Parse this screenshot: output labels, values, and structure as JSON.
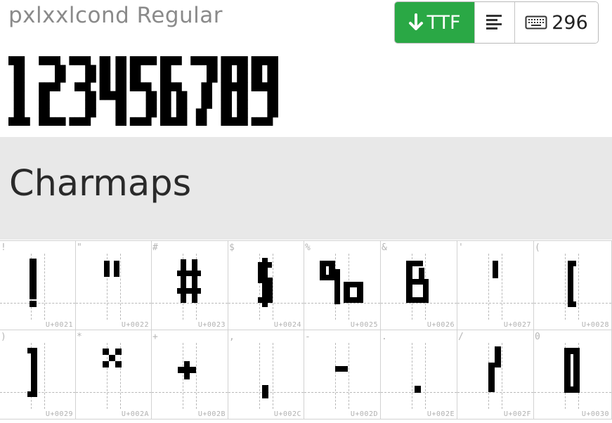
{
  "font": {
    "name": "pxlxxlcond Regular"
  },
  "toolbar": {
    "download_label": "TTF",
    "glyph_count": "296",
    "download_icon": "arrow-down-icon",
    "align_icon": "align-left-icon",
    "keyboard_icon": "keyboard-icon"
  },
  "sample": {
    "text": "123456789"
  },
  "section": {
    "title": "Charmaps"
  },
  "glyphs": [
    {
      "char": "!",
      "code": "U+0021"
    },
    {
      "char": "\"",
      "code": "U+0022"
    },
    {
      "char": "#",
      "code": "U+0023"
    },
    {
      "char": "$",
      "code": "U+0024"
    },
    {
      "char": "%",
      "code": "U+0025"
    },
    {
      "char": "&",
      "code": "U+0026"
    },
    {
      "char": "'",
      "code": "U+0027"
    },
    {
      "char": "(",
      "code": "U+0028"
    },
    {
      "char": ")",
      "code": "U+0029"
    },
    {
      "char": "*",
      "code": "U+002A"
    },
    {
      "char": "+",
      "code": "U+002B"
    },
    {
      "char": ",",
      "code": "U+002C"
    },
    {
      "char": "-",
      "code": "U+002D"
    },
    {
      "char": ".",
      "code": "U+002E"
    },
    {
      "char": "/",
      "code": "U+002F"
    },
    {
      "char": "0",
      "code": "U+0030"
    }
  ],
  "colors": {
    "download": "#2aa845",
    "band": "#e8e8e8"
  }
}
